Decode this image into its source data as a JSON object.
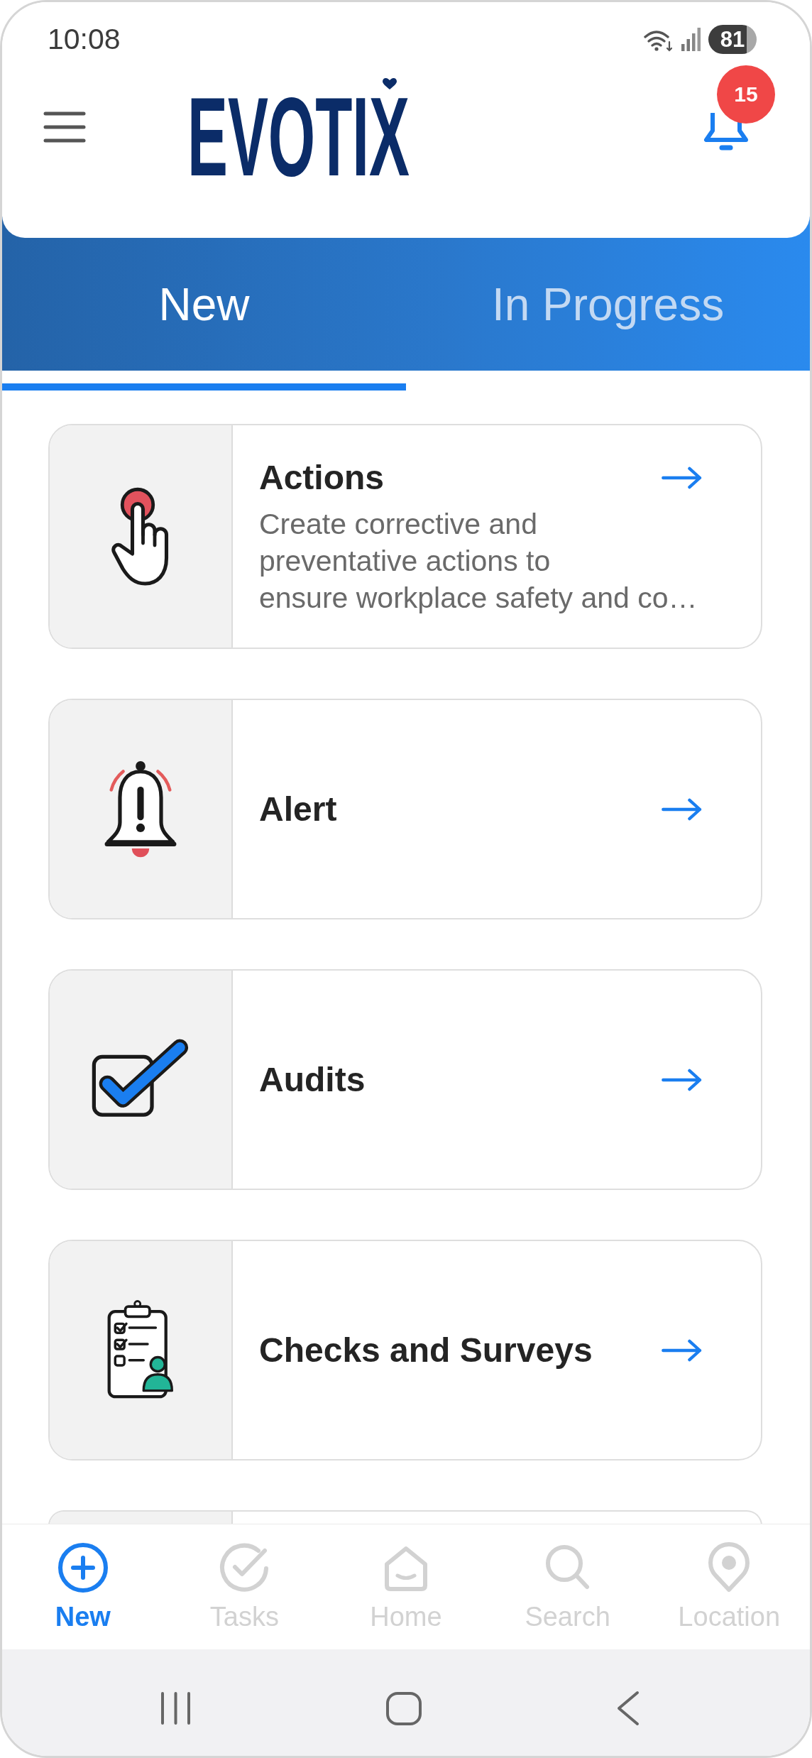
{
  "status_bar": {
    "time": "10:08",
    "battery": "81"
  },
  "header": {
    "logo": "EVOTIX",
    "notifications": "15"
  },
  "tabs": [
    {
      "label": "New",
      "selected": true
    },
    {
      "label": "In Progress",
      "selected": false
    }
  ],
  "modules": [
    {
      "kind": "action",
      "title": "Actions",
      "description": "Create corrective and\npreventative actions to\nensure workplace safety and co…"
    },
    {
      "kind": "alert",
      "title": "Alert"
    },
    {
      "kind": "audit",
      "title": "Audits"
    },
    {
      "kind": "survey",
      "title": "Checks and Surveys"
    },
    {
      "kind": "cut_off"
    }
  ],
  "bottom_nav": [
    {
      "kind": "new",
      "label": "New",
      "selected": true
    },
    {
      "kind": "tasks",
      "label": "Tasks",
      "selected": false
    },
    {
      "kind": "home",
      "label": "Home",
      "selected": false
    },
    {
      "kind": "search",
      "label": "Search",
      "selected": false
    },
    {
      "kind": "location",
      "label": "Location",
      "selected": false
    }
  ]
}
